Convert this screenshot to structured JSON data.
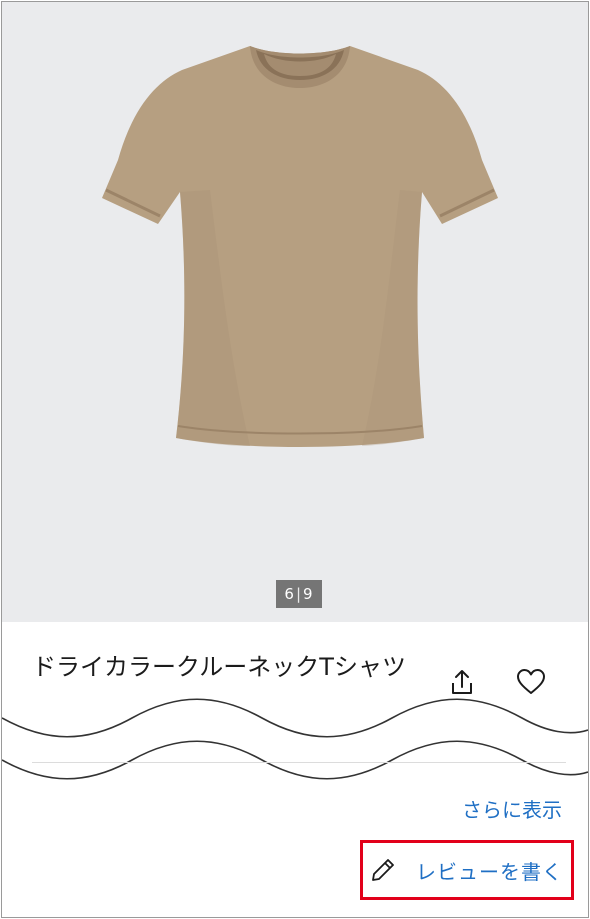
{
  "product": {
    "title": "ドライカラークルーネックTシャツ",
    "image": {
      "kind": "beige short-sleeve crew-neck t-shirt",
      "color": "#b69f81"
    }
  },
  "gallery": {
    "current": "6",
    "total": "9",
    "background": "#eaebed"
  },
  "actions": {
    "share_icon": "share-icon",
    "favorite_icon": "heart-icon"
  },
  "links": {
    "more": "さらに表示",
    "write_review": "レビューを書く",
    "review_icon": "pencil-icon"
  },
  "colors": {
    "link": "#1f6fc4",
    "highlight": "#e2001a",
    "counter_bg": "#757575"
  }
}
